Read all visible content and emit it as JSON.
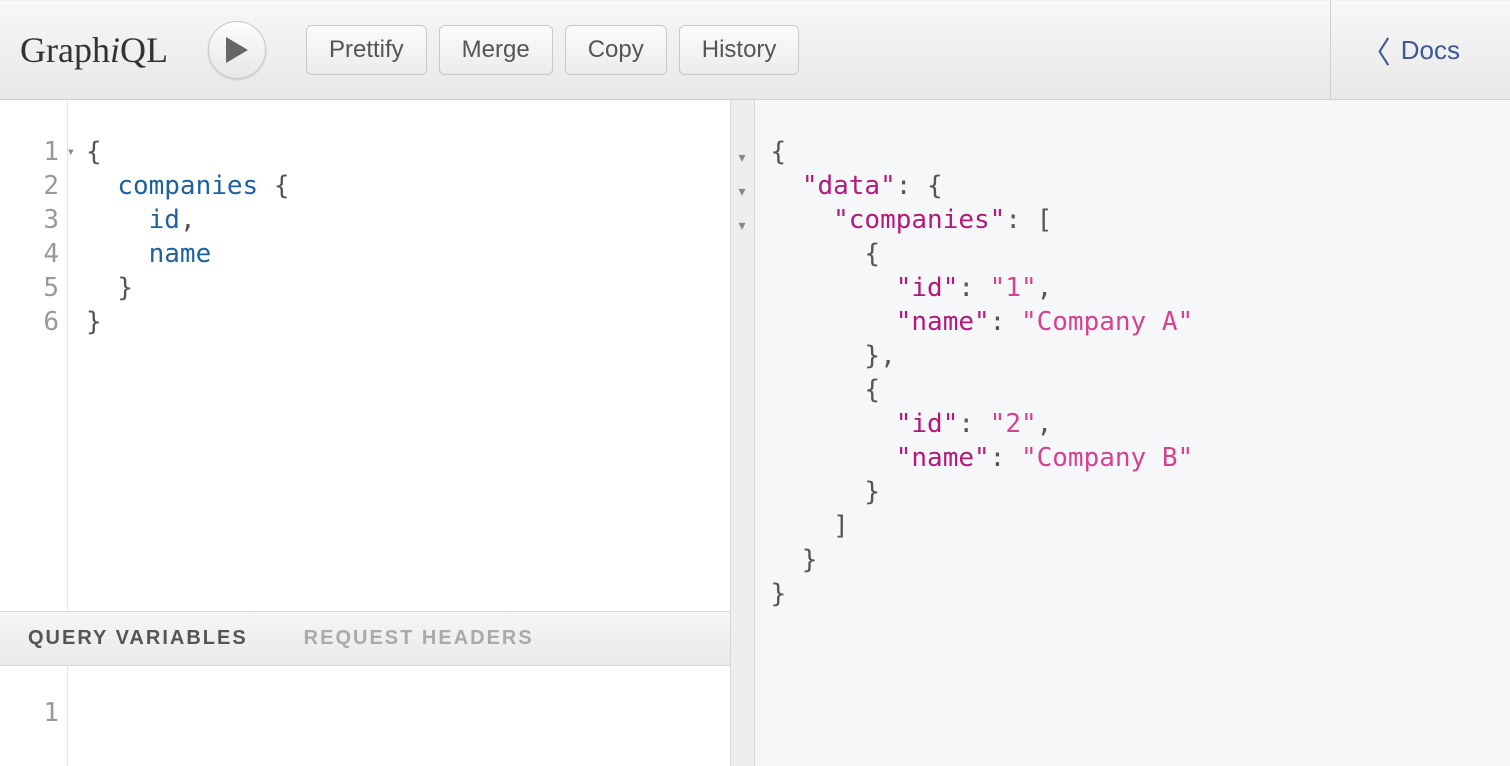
{
  "logo": {
    "prefix": "Graph",
    "i": "i",
    "suffix": "QL"
  },
  "toolbar": {
    "prettify": "Prettify",
    "merge": "Merge",
    "copy": "Copy",
    "history": "History"
  },
  "docs": {
    "label": "Docs"
  },
  "query_editor": {
    "line_numbers": [
      "1",
      "2",
      "3",
      "4",
      "5",
      "6"
    ],
    "fold_lines": [
      1
    ],
    "lines": [
      [
        {
          "t": "{",
          "c": "punc"
        }
      ],
      [
        {
          "t": "  ",
          "c": "punc"
        },
        {
          "t": "companies",
          "c": "field"
        },
        {
          "t": " {",
          "c": "punc"
        }
      ],
      [
        {
          "t": "    ",
          "c": "punc"
        },
        {
          "t": "id",
          "c": "field"
        },
        {
          "t": ",",
          "c": "punc"
        }
      ],
      [
        {
          "t": "    ",
          "c": "punc"
        },
        {
          "t": "name",
          "c": "field"
        }
      ],
      [
        {
          "t": "  ",
          "c": "punc"
        },
        {
          "t": "}",
          "c": "punc"
        }
      ],
      [
        {
          "t": "}",
          "c": "punc"
        }
      ]
    ]
  },
  "secondary_tabs": {
    "variables": "QUERY VARIABLES",
    "headers": "REQUEST HEADERS",
    "active": "variables"
  },
  "variables_editor": {
    "line_numbers": [
      "1"
    ]
  },
  "result_fold_markers": 3,
  "result_lines": [
    [
      {
        "t": "{",
        "c": "jpunc"
      }
    ],
    [
      {
        "t": "  ",
        "c": "jpunc"
      },
      {
        "t": "\"data\"",
        "c": "key"
      },
      {
        "t": ": {",
        "c": "jpunc"
      }
    ],
    [
      {
        "t": "    ",
        "c": "jpunc"
      },
      {
        "t": "\"companies\"",
        "c": "key"
      },
      {
        "t": ": [",
        "c": "jpunc"
      }
    ],
    [
      {
        "t": "      {",
        "c": "jpunc"
      }
    ],
    [
      {
        "t": "        ",
        "c": "jpunc"
      },
      {
        "t": "\"id\"",
        "c": "key"
      },
      {
        "t": ": ",
        "c": "jpunc"
      },
      {
        "t": "\"1\"",
        "c": "str"
      },
      {
        "t": ",",
        "c": "jpunc"
      }
    ],
    [
      {
        "t": "        ",
        "c": "jpunc"
      },
      {
        "t": "\"name\"",
        "c": "key"
      },
      {
        "t": ": ",
        "c": "jpunc"
      },
      {
        "t": "\"Company A\"",
        "c": "str"
      }
    ],
    [
      {
        "t": "      },",
        "c": "jpunc"
      }
    ],
    [
      {
        "t": "      {",
        "c": "jpunc"
      }
    ],
    [
      {
        "t": "        ",
        "c": "jpunc"
      },
      {
        "t": "\"id\"",
        "c": "key"
      },
      {
        "t": ": ",
        "c": "jpunc"
      },
      {
        "t": "\"2\"",
        "c": "str"
      },
      {
        "t": ",",
        "c": "jpunc"
      }
    ],
    [
      {
        "t": "        ",
        "c": "jpunc"
      },
      {
        "t": "\"name\"",
        "c": "key"
      },
      {
        "t": ": ",
        "c": "jpunc"
      },
      {
        "t": "\"Company B\"",
        "c": "str"
      }
    ],
    [
      {
        "t": "      }",
        "c": "jpunc"
      }
    ],
    [
      {
        "t": "    ]",
        "c": "jpunc"
      }
    ],
    [
      {
        "t": "  }",
        "c": "jpunc"
      }
    ],
    [
      {
        "t": "}",
        "c": "jpunc"
      }
    ]
  ]
}
